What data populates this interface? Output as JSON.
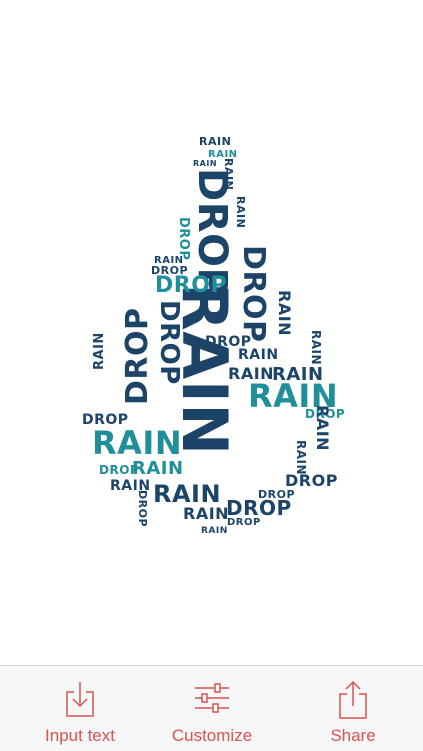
{
  "toolbar": {
    "input_text_label": "Input text",
    "customize_label": "Customize",
    "share_label": "Share",
    "accent_color": "#d9534f"
  },
  "word_cloud": {
    "words": [
      "RAIN",
      "DROP"
    ],
    "colors": {
      "dark": "#1c4468",
      "teal": "#1f8f9a"
    }
  }
}
